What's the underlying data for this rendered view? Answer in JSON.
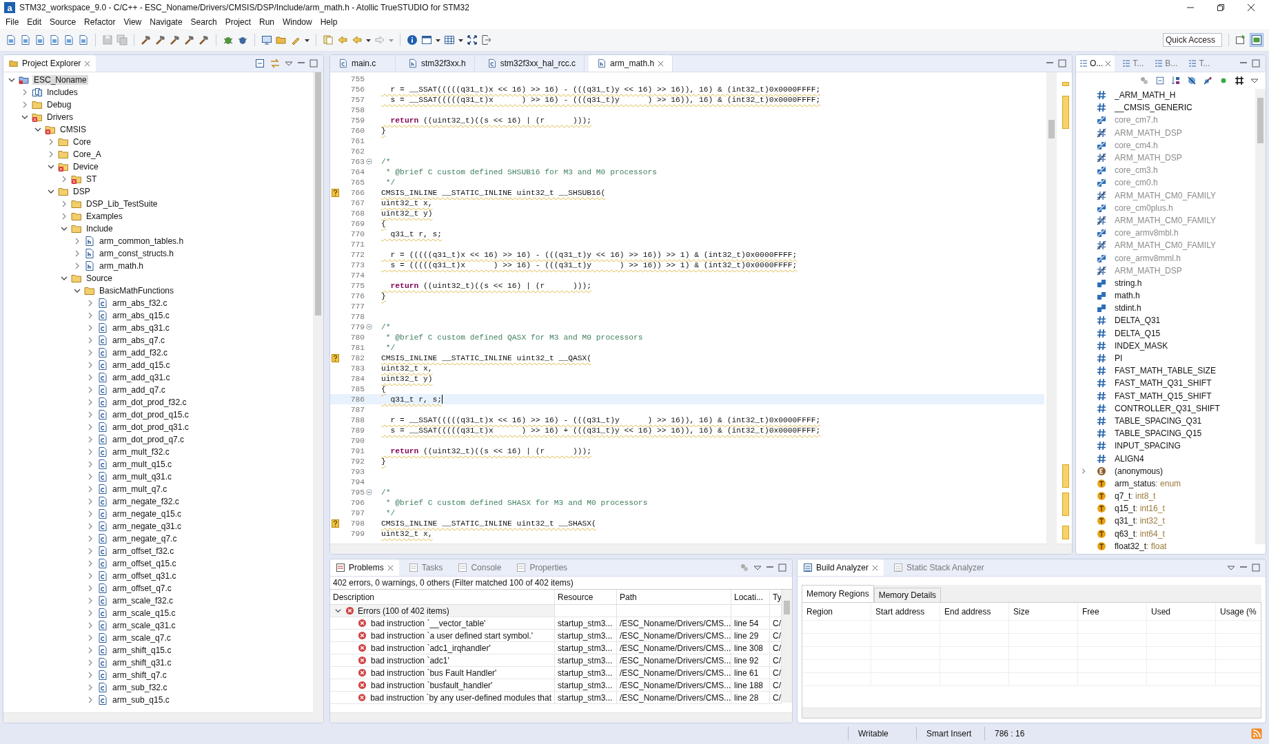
{
  "window": {
    "logo": "a",
    "title": "STM32_workspace_9.0 - C/C++ - ESC_Noname/Drivers/CMSIS/DSP/Include/arm_math.h - Atollic TrueSTUDIO for STM32"
  },
  "menu": [
    "File",
    "Edit",
    "Source",
    "Refactor",
    "View",
    "Navigate",
    "Search",
    "Project",
    "Run",
    "Window",
    "Help"
  ],
  "quick_access": {
    "placeholder": "Quick Access"
  },
  "project_explorer": {
    "title": "Project Explorer",
    "tree": [
      {
        "label": "ESC_Noname",
        "kind": "project",
        "expanded": true,
        "selected": true,
        "children": [
          {
            "label": "Includes",
            "kind": "includes",
            "expanded": false,
            "selected": false
          },
          {
            "label": "Debug",
            "kind": "folder",
            "expanded": false,
            "selected": false
          },
          {
            "label": "Drivers",
            "kind": "folder-error",
            "expanded": true,
            "selected": false,
            "children": [
              {
                "label": "CMSIS",
                "kind": "folder-error",
                "expanded": true,
                "selected": false,
                "children": [
                  {
                    "label": "Core",
                    "kind": "folder",
                    "expanded": false,
                    "selected": false
                  },
                  {
                    "label": "Core_A",
                    "kind": "folder",
                    "expanded": false,
                    "selected": false
                  },
                  {
                    "label": "Device",
                    "kind": "folder-error",
                    "expanded": true,
                    "selected": false,
                    "children": [
                      {
                        "label": "ST",
                        "kind": "folder-error",
                        "expanded": false,
                        "selected": false
                      }
                    ]
                  },
                  {
                    "label": "DSP",
                    "kind": "folder",
                    "expanded": true,
                    "selected": false,
                    "children": [
                      {
                        "label": "DSP_Lib_TestSuite",
                        "kind": "folder",
                        "expanded": false,
                        "selected": false
                      },
                      {
                        "label": "Examples",
                        "kind": "folder",
                        "expanded": false,
                        "selected": false
                      },
                      {
                        "label": "Include",
                        "kind": "folder",
                        "expanded": true,
                        "selected": false,
                        "children": [
                          {
                            "label": "arm_common_tables.h",
                            "kind": "header",
                            "expanded": false,
                            "selected": false
                          },
                          {
                            "label": "arm_const_structs.h",
                            "kind": "header",
                            "expanded": false,
                            "selected": false
                          },
                          {
                            "label": "arm_math.h",
                            "kind": "header",
                            "expanded": false,
                            "selected": false
                          }
                        ]
                      },
                      {
                        "label": "Source",
                        "kind": "folder",
                        "expanded": true,
                        "selected": false,
                        "children": [
                          {
                            "label": "BasicMathFunctions",
                            "kind": "folder",
                            "expanded": true,
                            "selected": false,
                            "children": [
                              {
                                "label": "arm_abs_f32.c",
                                "kind": "source",
                                "expanded": false,
                                "selected": false
                              },
                              {
                                "label": "arm_abs_q15.c",
                                "kind": "source",
                                "expanded": false,
                                "selected": false
                              },
                              {
                                "label": "arm_abs_q31.c",
                                "kind": "source",
                                "expanded": false,
                                "selected": false
                              },
                              {
                                "label": "arm_abs_q7.c",
                                "kind": "source",
                                "expanded": false,
                                "selected": false
                              },
                              {
                                "label": "arm_add_f32.c",
                                "kind": "source",
                                "expanded": false,
                                "selected": false
                              },
                              {
                                "label": "arm_add_q15.c",
                                "kind": "source",
                                "expanded": false,
                                "selected": false
                              },
                              {
                                "label": "arm_add_q31.c",
                                "kind": "source",
                                "expanded": false,
                                "selected": false
                              },
                              {
                                "label": "arm_add_q7.c",
                                "kind": "source",
                                "expanded": false,
                                "selected": false
                              },
                              {
                                "label": "arm_dot_prod_f32.c",
                                "kind": "source",
                                "expanded": false,
                                "selected": false
                              },
                              {
                                "label": "arm_dot_prod_q15.c",
                                "kind": "source",
                                "expanded": false,
                                "selected": false
                              },
                              {
                                "label": "arm_dot_prod_q31.c",
                                "kind": "source",
                                "expanded": false,
                                "selected": false
                              },
                              {
                                "label": "arm_dot_prod_q7.c",
                                "kind": "source",
                                "expanded": false,
                                "selected": false
                              },
                              {
                                "label": "arm_mult_f32.c",
                                "kind": "source",
                                "expanded": false,
                                "selected": false
                              },
                              {
                                "label": "arm_mult_q15.c",
                                "kind": "source",
                                "expanded": false,
                                "selected": false
                              },
                              {
                                "label": "arm_mult_q31.c",
                                "kind": "source",
                                "expanded": false,
                                "selected": false
                              },
                              {
                                "label": "arm_mult_q7.c",
                                "kind": "source",
                                "expanded": false,
                                "selected": false
                              },
                              {
                                "label": "arm_negate_f32.c",
                                "kind": "source",
                                "expanded": false,
                                "selected": false
                              },
                              {
                                "label": "arm_negate_q15.c",
                                "kind": "source",
                                "expanded": false,
                                "selected": false
                              },
                              {
                                "label": "arm_negate_q31.c",
                                "kind": "source",
                                "expanded": false,
                                "selected": false
                              },
                              {
                                "label": "arm_negate_q7.c",
                                "kind": "source",
                                "expanded": false,
                                "selected": false
                              },
                              {
                                "label": "arm_offset_f32.c",
                                "kind": "source",
                                "expanded": false,
                                "selected": false
                              },
                              {
                                "label": "arm_offset_q15.c",
                                "kind": "source",
                                "expanded": false,
                                "selected": false
                              },
                              {
                                "label": "arm_offset_q31.c",
                                "kind": "source",
                                "expanded": false,
                                "selected": false
                              },
                              {
                                "label": "arm_offset_q7.c",
                                "kind": "source",
                                "expanded": false,
                                "selected": false
                              },
                              {
                                "label": "arm_scale_f32.c",
                                "kind": "source",
                                "expanded": false,
                                "selected": false
                              },
                              {
                                "label": "arm_scale_q15.c",
                                "kind": "source",
                                "expanded": false,
                                "selected": false
                              },
                              {
                                "label": "arm_scale_q31.c",
                                "kind": "source",
                                "expanded": false,
                                "selected": false
                              },
                              {
                                "label": "arm_scale_q7.c",
                                "kind": "source",
                                "expanded": false,
                                "selected": false
                              },
                              {
                                "label": "arm_shift_q15.c",
                                "kind": "source",
                                "expanded": false,
                                "selected": false
                              },
                              {
                                "label": "arm_shift_q31.c",
                                "kind": "source",
                                "expanded": false,
                                "selected": false
                              },
                              {
                                "label": "arm_shift_q7.c",
                                "kind": "source",
                                "expanded": false,
                                "selected": false
                              },
                              {
                                "label": "arm_sub_f32.c",
                                "kind": "source",
                                "expanded": false,
                                "selected": false
                              },
                              {
                                "label": "arm_sub_q15.c",
                                "kind": "source",
                                "expanded": false,
                                "selected": false
                              }
                            ]
                          }
                        ]
                      }
                    ]
                  }
                ]
              }
            ]
          }
        ]
      }
    ]
  },
  "editor": {
    "tabs": [
      {
        "label": "main.c",
        "kind": "source",
        "selected": false
      },
      {
        "label": "stm32f3xx.h",
        "kind": "header",
        "selected": false
      },
      {
        "label": "stm32f3xx_hal_rcc.c",
        "kind": "source",
        "selected": false
      },
      {
        "label": "arm_math.h",
        "kind": "header",
        "selected": true
      }
    ],
    "lines": [
      {
        "number": "755",
        "kind": "blank",
        "warning": false,
        "fold": false,
        "current": false
      },
      {
        "number": "756",
        "kind": "code",
        "text": "  r = __SSAT(((((q31_t)x << 16) >> 16) - (((q31_t)y << 16) >> 16)), 16) & (int32_t)0x0000FFFF;",
        "warning": false,
        "fold": false,
        "current": false
      },
      {
        "number": "757",
        "kind": "code",
        "text": "  s = __SSAT(((((q31_t)x      ) >> 16) - (((q31_t)y      ) >> 16)), 16) & (int32_t)0x0000FFFF;",
        "warning": false,
        "fold": false,
        "current": false
      },
      {
        "number": "758",
        "kind": "blank",
        "warning": false,
        "fold": false,
        "current": false
      },
      {
        "number": "759",
        "kind": "code",
        "text": "  **return** ((uint32_t)((s << 16) | (r      )));",
        "warning": false,
        "fold": false,
        "current": false
      },
      {
        "number": "760",
        "kind": "code",
        "text": "}",
        "warning": false,
        "fold": false,
        "current": false
      },
      {
        "number": "761",
        "kind": "blank",
        "warning": false,
        "fold": false,
        "current": false
      },
      {
        "number": "762",
        "kind": "blank",
        "warning": false,
        "fold": false,
        "current": false
      },
      {
        "number": "763",
        "kind": "comment",
        "text": "/*",
        "warning": false,
        "fold": true,
        "current": false
      },
      {
        "number": "764",
        "kind": "comment",
        "text": " * @brief C custom defined SHSUB16 for M3 and M0 processors",
        "warning": false,
        "fold": false,
        "current": false
      },
      {
        "number": "765",
        "kind": "comment",
        "text": " */",
        "warning": false,
        "fold": false,
        "current": false
      },
      {
        "number": "766",
        "kind": "code",
        "text": "CMSIS_INLINE __STATIC_INLINE uint32_t __SHSUB16(",
        "warning": true,
        "fold": false,
        "current": false
      },
      {
        "number": "767",
        "kind": "code",
        "text": "uint32_t x,",
        "warning": false,
        "fold": false,
        "current": false
      },
      {
        "number": "768",
        "kind": "code",
        "text": "uint32_t y)",
        "warning": false,
        "fold": false,
        "current": false
      },
      {
        "number": "769",
        "kind": "code",
        "text": "{",
        "warning": false,
        "fold": false,
        "current": false
      },
      {
        "number": "770",
        "kind": "code",
        "text": "  q31_t r, s;",
        "warning": false,
        "fold": false,
        "current": false
      },
      {
        "number": "771",
        "kind": "blank",
        "warning": false,
        "fold": false,
        "current": false
      },
      {
        "number": "772",
        "kind": "code",
        "text": "  r = (((((q31_t)x << 16) >> 16) - (((q31_t)y << 16) >> 16)) >> 1) & (int32_t)0x0000FFFF;",
        "warning": false,
        "fold": false,
        "current": false
      },
      {
        "number": "773",
        "kind": "code",
        "text": "  s = (((((q31_t)x      ) >> 16) - (((q31_t)y      ) >> 16)) >> 1) & (int32_t)0x0000FFFF;",
        "warning": false,
        "fold": false,
        "current": false
      },
      {
        "number": "774",
        "kind": "blank",
        "warning": false,
        "fold": false,
        "current": false
      },
      {
        "number": "775",
        "kind": "code",
        "text": "  **return** ((uint32_t)((s << 16) | (r      )));",
        "warning": false,
        "fold": false,
        "current": false
      },
      {
        "number": "776",
        "kind": "code",
        "text": "}",
        "warning": false,
        "fold": false,
        "current": false
      },
      {
        "number": "777",
        "kind": "blank",
        "warning": false,
        "fold": false,
        "current": false
      },
      {
        "number": "778",
        "kind": "blank",
        "warning": false,
        "fold": false,
        "current": false
      },
      {
        "number": "779",
        "kind": "comment",
        "text": "/*",
        "warning": false,
        "fold": true,
        "current": false
      },
      {
        "number": "780",
        "kind": "comment",
        "text": " * @brief C custom defined QASX for M3 and M0 processors",
        "warning": false,
        "fold": false,
        "current": false
      },
      {
        "number": "781",
        "kind": "comment",
        "text": " */",
        "warning": false,
        "fold": false,
        "current": false
      },
      {
        "number": "782",
        "kind": "code",
        "text": "CMSIS_INLINE __STATIC_INLINE uint32_t __QASX(",
        "warning": true,
        "fold": false,
        "current": false
      },
      {
        "number": "783",
        "kind": "code",
        "text": "uint32_t x,",
        "warning": false,
        "fold": false,
        "current": false
      },
      {
        "number": "784",
        "kind": "code",
        "text": "uint32_t y)",
        "warning": false,
        "fold": false,
        "current": false
      },
      {
        "number": "785",
        "kind": "code",
        "text": "{",
        "warning": false,
        "fold": false,
        "current": false
      },
      {
        "number": "786",
        "kind": "code",
        "text": "  q31_t r, s;",
        "warning": false,
        "fold": false,
        "current": true
      },
      {
        "number": "787",
        "kind": "blank",
        "warning": false,
        "fold": false,
        "current": false
      },
      {
        "number": "788",
        "kind": "code",
        "text": "  r = __SSAT(((((q31_t)x << 16) >> 16) - (((q31_t)y      ) >> 16)), 16) & (int32_t)0x0000FFFF;",
        "warning": false,
        "fold": false,
        "current": false
      },
      {
        "number": "789",
        "kind": "code",
        "text": "  s = __SSAT(((((q31_t)x      ) >> 16) + (((q31_t)y << 16) >> 16)), 16) & (int32_t)0x0000FFFF;",
        "warning": false,
        "fold": false,
        "current": false
      },
      {
        "number": "790",
        "kind": "blank",
        "warning": false,
        "fold": false,
        "current": false
      },
      {
        "number": "791",
        "kind": "code",
        "text": "  **return** ((uint32_t)((s << 16) | (r      )));",
        "warning": false,
        "fold": false,
        "current": false
      },
      {
        "number": "792",
        "kind": "code",
        "text": "}",
        "warning": false,
        "fold": false,
        "current": false
      },
      {
        "number": "793",
        "kind": "blank",
        "warning": false,
        "fold": false,
        "current": false
      },
      {
        "number": "794",
        "kind": "blank",
        "warning": false,
        "fold": false,
        "current": false
      },
      {
        "number": "795",
        "kind": "comment",
        "text": "/*",
        "warning": false,
        "fold": true,
        "current": false
      },
      {
        "number": "796",
        "kind": "comment",
        "text": " * @brief C custom defined SHASX for M3 and M0 processors",
        "warning": false,
        "fold": false,
        "current": false
      },
      {
        "number": "797",
        "kind": "comment",
        "text": " */",
        "warning": false,
        "fold": false,
        "current": false
      },
      {
        "number": "798",
        "kind": "code",
        "text": "CMSIS_INLINE __STATIC_INLINE uint32_t __SHASX(",
        "warning": true,
        "fold": false,
        "current": false
      },
      {
        "number": "799",
        "kind": "code",
        "text": "uint32_t x,",
        "warning": false,
        "fold": false,
        "current": false
      }
    ]
  },
  "outline": {
    "tabs": [
      {
        "label": "O...",
        "selected": true
      },
      {
        "label": "T...",
        "selected": false
      },
      {
        "label": "B...",
        "selected": false
      },
      {
        "label": "T...",
        "selected": false
      }
    ],
    "items": [
      {
        "label": "_ARM_MATH_H",
        "kind": "macro",
        "inactive": false
      },
      {
        "label": "__CMSIS_GENERIC",
        "kind": "macro",
        "inactive": false
      },
      {
        "label": "core_cm7.h",
        "kind": "include",
        "inactive": true
      },
      {
        "label": "ARM_MATH_DSP",
        "kind": "macro",
        "inactive": true
      },
      {
        "label": "core_cm4.h",
        "kind": "include",
        "inactive": true
      },
      {
        "label": "ARM_MATH_DSP",
        "kind": "macro",
        "inactive": true
      },
      {
        "label": "core_cm3.h",
        "kind": "include",
        "inactive": true
      },
      {
        "label": "core_cm0.h",
        "kind": "include",
        "inactive": true
      },
      {
        "label": "ARM_MATH_CM0_FAMILY",
        "kind": "macro",
        "inactive": true
      },
      {
        "label": "core_cm0plus.h",
        "kind": "include",
        "inactive": true
      },
      {
        "label": "ARM_MATH_CM0_FAMILY",
        "kind": "macro",
        "inactive": true
      },
      {
        "label": "core_armv8mbl.h",
        "kind": "include",
        "inactive": true
      },
      {
        "label": "ARM_MATH_CM0_FAMILY",
        "kind": "macro",
        "inactive": true
      },
      {
        "label": "core_armv8mml.h",
        "kind": "include",
        "inactive": true
      },
      {
        "label": "ARM_MATH_DSP",
        "kind": "macro",
        "inactive": true
      },
      {
        "label": "string.h",
        "kind": "include",
        "inactive": false
      },
      {
        "label": "math.h",
        "kind": "include",
        "inactive": false
      },
      {
        "label": "stdint.h",
        "kind": "include",
        "inactive": false
      },
      {
        "label": "DELTA_Q31",
        "kind": "macro",
        "inactive": false
      },
      {
        "label": "DELTA_Q15",
        "kind": "macro",
        "inactive": false
      },
      {
        "label": "INDEX_MASK",
        "kind": "macro",
        "inactive": false
      },
      {
        "label": "PI",
        "kind": "macro",
        "inactive": false
      },
      {
        "label": "FAST_MATH_TABLE_SIZE",
        "kind": "macro",
        "inactive": false
      },
      {
        "label": "FAST_MATH_Q31_SHIFT",
        "kind": "macro",
        "inactive": false
      },
      {
        "label": "FAST_MATH_Q15_SHIFT",
        "kind": "macro",
        "inactive": false
      },
      {
        "label": "CONTROLLER_Q31_SHIFT",
        "kind": "macro",
        "inactive": false
      },
      {
        "label": "TABLE_SPACING_Q31",
        "kind": "macro",
        "inactive": false
      },
      {
        "label": "TABLE_SPACING_Q15",
        "kind": "macro",
        "inactive": false
      },
      {
        "label": "INPUT_SPACING",
        "kind": "macro",
        "inactive": false
      },
      {
        "label": "ALIGN4",
        "kind": "macro",
        "inactive": false
      },
      {
        "label": "(anonymous)",
        "kind": "enum",
        "inactive": false,
        "expanded": false
      },
      {
        "label": "arm_status",
        "type": ": enum",
        "kind": "typedef",
        "inactive": false
      },
      {
        "label": "q7_t",
        "type": ": int8_t",
        "kind": "typedef",
        "inactive": false
      },
      {
        "label": "q15_t",
        "type": ": int16_t",
        "kind": "typedef",
        "inactive": false
      },
      {
        "label": "q31_t",
        "type": ": int32_t",
        "kind": "typedef",
        "inactive": false
      },
      {
        "label": "q63_t",
        "type": ": int64_t",
        "kind": "typedef",
        "inactive": false
      },
      {
        "label": "float32_t",
        "type": ": float",
        "kind": "typedef",
        "inactive": false
      }
    ]
  },
  "problems": {
    "tabs": [
      {
        "label": "Problems",
        "selected": true
      },
      {
        "label": "Tasks",
        "selected": false
      },
      {
        "label": "Console",
        "selected": false
      },
      {
        "label": "Properties",
        "selected": false
      }
    ],
    "summary": "402 errors, 0 warnings, 0 others (Filter matched 100 of 402 items)",
    "columns": [
      "Description",
      "Resource",
      "Path",
      "Locati...",
      "Ty"
    ],
    "group": {
      "label": "Errors (100 of 402 items)",
      "expanded": true
    },
    "rows": [
      {
        "description": "bad instruction `__vector_table'",
        "resource": "startup_stm3...",
        "path": "/ESC_Noname/Drivers/CMS...",
        "location": "line 54",
        "type": "C/"
      },
      {
        "description": "bad instruction `a user defined start symbol.'",
        "resource": "startup_stm3...",
        "path": "/ESC_Noname/Drivers/CMS...",
        "location": "line 29",
        "type": "C/"
      },
      {
        "description": "bad instruction `adc1_irqhandler'",
        "resource": "startup_stm3...",
        "path": "/ESC_Noname/Drivers/CMS...",
        "location": "line 308",
        "type": "C/"
      },
      {
        "description": "bad instruction `adc1'",
        "resource": "startup_stm3...",
        "path": "/ESC_Noname/Drivers/CMS...",
        "location": "line 92",
        "type": "C/"
      },
      {
        "description": "bad instruction `bus Fault Handler'",
        "resource": "startup_stm3...",
        "path": "/ESC_Noname/Drivers/CMS...",
        "location": "line 61",
        "type": "C/"
      },
      {
        "description": "bad instruction `busfault_handler'",
        "resource": "startup_stm3...",
        "path": "/ESC_Noname/Drivers/CMS...",
        "location": "line 188",
        "type": "C/"
      },
      {
        "description": "bad instruction `by any user-defined modules that",
        "resource": "startup_stm3...",
        "path": "/ESC_Noname/Drivers/CMS...",
        "location": "line 28",
        "type": "C/"
      }
    ]
  },
  "build_analyzer": {
    "tabs": [
      {
        "label": "Build Analyzer",
        "selected": true
      },
      {
        "label": "Static Stack Analyzer",
        "selected": false
      }
    ],
    "inner_tabs": [
      {
        "label": "Memory Regions",
        "selected": true
      },
      {
        "label": "Memory Details",
        "selected": false
      }
    ],
    "columns": [
      "Region",
      "Start address",
      "End address",
      "Size",
      "Free",
      "Used",
      "Usage (%"
    ]
  },
  "status_bar": [
    "Writable",
    "Smart Insert",
    "786 : 16"
  ]
}
